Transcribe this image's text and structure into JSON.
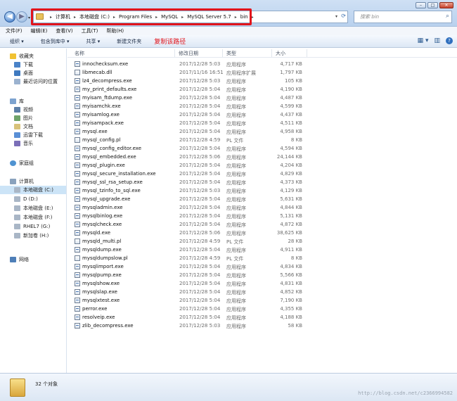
{
  "window": {
    "min": "–",
    "max": "□",
    "close": "✕"
  },
  "address": {
    "crumbs": [
      "计算机",
      "本地磁盘 (C:)",
      "Program Files",
      "MySQL",
      "MySQL Server 5.7",
      "bin"
    ],
    "separator": "▸",
    "dropdown_icon": "▾",
    "refresh_icon": "⟳",
    "highlight_color": "#e2141b"
  },
  "search": {
    "placeholder": "搜索 bin",
    "icon": "⌕"
  },
  "menu": [
    "文件(F)",
    "编辑(E)",
    "查看(V)",
    "工具(T)",
    "帮助(H)"
  ],
  "toolbar": {
    "organize": "组织 ▾",
    "include": "包含到库中 ▾",
    "share": "共享 ▾",
    "new_folder": "新建文件夹",
    "annotation": "复制该路径",
    "view_icon": "▦ ▾",
    "pane_icon": "▥",
    "help_icon": "?"
  },
  "nav": {
    "favorites": "收藏夹",
    "downloads": "下载",
    "desktop": "桌面",
    "recent": "最近访问的位置",
    "libraries": "库",
    "videos": "视频",
    "pictures": "图片",
    "documents": "文档",
    "xunlei": "迅雷下载",
    "music": "音乐",
    "homegroup": "家庭组",
    "computer": "计算机",
    "drive_c": "本地磁盘 (C:)",
    "drive_d": "D (D:)",
    "drive_e": "本地磁盘 (E:)",
    "drive_f": "本地磁盘 (F:)",
    "drive_g": "RHEL7 (G:)",
    "drive_h": "新加卷 (H:)",
    "network": "网络"
  },
  "columns": {
    "name": "名称",
    "date": "修改日期",
    "type": "类型",
    "size": "大小"
  },
  "files": [
    {
      "name": "innochecksum.exe",
      "date": "2017/12/28 5:03",
      "type": "应用程序",
      "size": "4,717 KB",
      "kind": "exe"
    },
    {
      "name": "libmecab.dll",
      "date": "2017/11/16 16:51",
      "type": "应用程序扩展",
      "size": "1,797 KB",
      "kind": "dll"
    },
    {
      "name": "lz4_decompress.exe",
      "date": "2017/12/28 5:03",
      "type": "应用程序",
      "size": "105 KB",
      "kind": "exe"
    },
    {
      "name": "my_print_defaults.exe",
      "date": "2017/12/28 5:04",
      "type": "应用程序",
      "size": "4,190 KB",
      "kind": "exe"
    },
    {
      "name": "myisam_ftdump.exe",
      "date": "2017/12/28 5:04",
      "type": "应用程序",
      "size": "4,487 KB",
      "kind": "exe"
    },
    {
      "name": "myisamchk.exe",
      "date": "2017/12/28 5:04",
      "type": "应用程序",
      "size": "4,599 KB",
      "kind": "exe"
    },
    {
      "name": "myisamlog.exe",
      "date": "2017/12/28 5:04",
      "type": "应用程序",
      "size": "4,437 KB",
      "kind": "exe"
    },
    {
      "name": "myisampack.exe",
      "date": "2017/12/28 5:04",
      "type": "应用程序",
      "size": "4,511 KB",
      "kind": "exe"
    },
    {
      "name": "mysql.exe",
      "date": "2017/12/28 5:04",
      "type": "应用程序",
      "size": "4,958 KB",
      "kind": "exe"
    },
    {
      "name": "mysql_config.pl",
      "date": "2017/12/28 4:59",
      "type": "PL 文件",
      "size": "8 KB",
      "kind": "pl"
    },
    {
      "name": "mysql_config_editor.exe",
      "date": "2017/12/28 5:04",
      "type": "应用程序",
      "size": "4,594 KB",
      "kind": "exe"
    },
    {
      "name": "mysql_embedded.exe",
      "date": "2017/12/28 5:06",
      "type": "应用程序",
      "size": "24,144 KB",
      "kind": "exe"
    },
    {
      "name": "mysql_plugin.exe",
      "date": "2017/12/28 5:04",
      "type": "应用程序",
      "size": "4,204 KB",
      "kind": "exe"
    },
    {
      "name": "mysql_secure_installation.exe",
      "date": "2017/12/28 5:04",
      "type": "应用程序",
      "size": "4,829 KB",
      "kind": "exe"
    },
    {
      "name": "mysql_ssl_rsa_setup.exe",
      "date": "2017/12/28 5:04",
      "type": "应用程序",
      "size": "4,373 KB",
      "kind": "exe"
    },
    {
      "name": "mysql_tzinfo_to_sql.exe",
      "date": "2017/12/28 5:03",
      "type": "应用程序",
      "size": "4,129 KB",
      "kind": "exe"
    },
    {
      "name": "mysql_upgrade.exe",
      "date": "2017/12/28 5:04",
      "type": "应用程序",
      "size": "5,631 KB",
      "kind": "exe"
    },
    {
      "name": "mysqladmin.exe",
      "date": "2017/12/28 5:04",
      "type": "应用程序",
      "size": "4,844 KB",
      "kind": "exe"
    },
    {
      "name": "mysqlbinlog.exe",
      "date": "2017/12/28 5:04",
      "type": "应用程序",
      "size": "5,131 KB",
      "kind": "exe"
    },
    {
      "name": "mysqlcheck.exe",
      "date": "2017/12/28 5:04",
      "type": "应用程序",
      "size": "4,872 KB",
      "kind": "exe"
    },
    {
      "name": "mysqld.exe",
      "date": "2017/12/28 5:06",
      "type": "应用程序",
      "size": "38,625 KB",
      "kind": "exe"
    },
    {
      "name": "mysqld_multi.pl",
      "date": "2017/12/28 4:59",
      "type": "PL 文件",
      "size": "28 KB",
      "kind": "pl"
    },
    {
      "name": "mysqldump.exe",
      "date": "2017/12/28 5:04",
      "type": "应用程序",
      "size": "4,911 KB",
      "kind": "exe"
    },
    {
      "name": "mysqldumpslow.pl",
      "date": "2017/12/28 4:59",
      "type": "PL 文件",
      "size": "8 KB",
      "kind": "pl"
    },
    {
      "name": "mysqlimport.exe",
      "date": "2017/12/28 5:04",
      "type": "应用程序",
      "size": "4,834 KB",
      "kind": "exe"
    },
    {
      "name": "mysqlpump.exe",
      "date": "2017/12/28 5:04",
      "type": "应用程序",
      "size": "5,566 KB",
      "kind": "exe"
    },
    {
      "name": "mysqlshow.exe",
      "date": "2017/12/28 5:04",
      "type": "应用程序",
      "size": "4,831 KB",
      "kind": "exe"
    },
    {
      "name": "mysqlslap.exe",
      "date": "2017/12/28 5:04",
      "type": "应用程序",
      "size": "4,852 KB",
      "kind": "exe"
    },
    {
      "name": "mysqlxtest.exe",
      "date": "2017/12/28 5:04",
      "type": "应用程序",
      "size": "7,190 KB",
      "kind": "exe"
    },
    {
      "name": "perror.exe",
      "date": "2017/12/28 5:04",
      "type": "应用程序",
      "size": "4,355 KB",
      "kind": "exe"
    },
    {
      "name": "resolveip.exe",
      "date": "2017/12/28 5:04",
      "type": "应用程序",
      "size": "4,188 KB",
      "kind": "exe"
    },
    {
      "name": "zlib_decompress.exe",
      "date": "2017/12/28 5:03",
      "type": "应用程序",
      "size": "58 KB",
      "kind": "exe"
    }
  ],
  "status": {
    "count": "32 个对象"
  },
  "watermark": "http://blog.csdn.net/c2366994582"
}
